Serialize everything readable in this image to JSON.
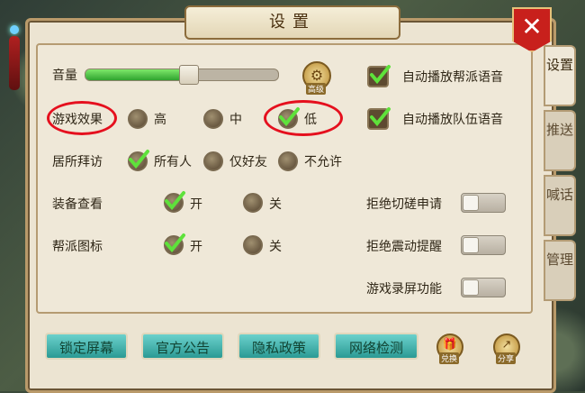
{
  "window": {
    "title": "设置",
    "close_symbol": "✕"
  },
  "tabs": [
    {
      "label": "设置",
      "active": true
    },
    {
      "label": "推送",
      "active": false
    },
    {
      "label": "喊话",
      "active": false
    },
    {
      "label": "管理",
      "active": false
    }
  ],
  "volume": {
    "label": "音量",
    "level": 0.55
  },
  "quality_button": {
    "caption": "高级"
  },
  "game_effect": {
    "label": "游戏效果",
    "options": [
      "高",
      "中",
      "低"
    ],
    "selected": "低"
  },
  "visit": {
    "label": "居所拜访",
    "options": [
      "所有人",
      "仅好友",
      "不允许"
    ],
    "selected": "所有人"
  },
  "equip_view": {
    "label": "装备查看",
    "options": [
      "开",
      "关"
    ],
    "selected": "开"
  },
  "guild_icon": {
    "label": "帮派图标",
    "options": [
      "开",
      "关"
    ],
    "selected": "开"
  },
  "auto_voice": [
    {
      "label": "自动播放帮派语音",
      "checked": true
    },
    {
      "label": "自动播放队伍语音",
      "checked": true
    }
  ],
  "toggles": [
    {
      "label": "拒绝切磋申请",
      "on": false
    },
    {
      "label": "拒绝震动提醒",
      "on": false
    },
    {
      "label": "游戏录屏功能",
      "on": false
    }
  ],
  "bottom_buttons": [
    "锁定屏幕",
    "官方公告",
    "隐私政策",
    "网络检测"
  ],
  "bottom_icons": [
    {
      "caption": "兑换",
      "icon": "gift-icon"
    },
    {
      "caption": "分享",
      "icon": "share-icon"
    }
  ],
  "colors": {
    "accent": "#2fa32f",
    "highlight": "#e5101e",
    "button": "#3aaaa4",
    "close": "#c8201c"
  }
}
